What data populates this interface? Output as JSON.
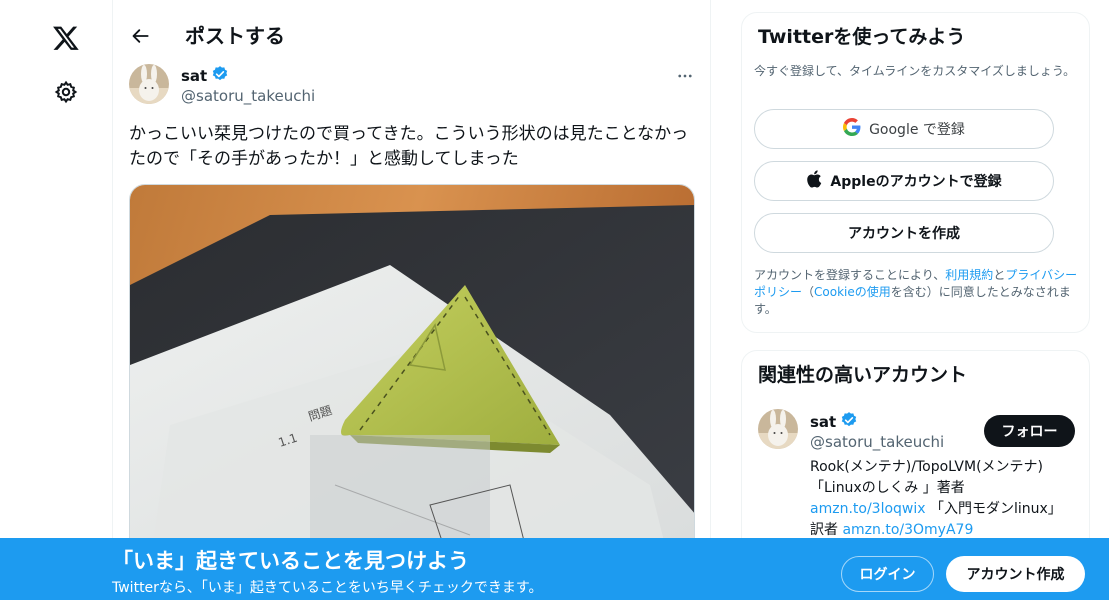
{
  "nav": {
    "logo_icon": "x-logo-icon",
    "settings_icon": "gear-icon"
  },
  "header": {
    "title": "ポストする"
  },
  "post": {
    "author_name": "sat",
    "author_handle": "@satoru_takeuchi",
    "text_lines": [
      "かっこいい栞見つけたので買ってきた。こういう形状のは見たことなかっ",
      "たので「その手があったか！」と感動してしまった"
    ],
    "media_texts": [
      "1.1",
      "問題"
    ]
  },
  "signup": {
    "title": "Twitterを使ってみよう",
    "subtitle": "今すぐ登録して、タイムラインをカスタマイズしましょう。",
    "google_label": "Google で登録",
    "apple_label": "Appleのアカウントで登録",
    "create_label": "アカウントを作成",
    "terms_part1": "アカウントを登録することにより、",
    "terms_link1": "利用規約",
    "terms_part2": "と",
    "terms_link2": "プライバシーポリシー",
    "terms_part3": "（",
    "terms_link3": "Cookieの使用",
    "terms_part4": "を含む）に同意したとみなされます。"
  },
  "related": {
    "title": "関連性の高いアカウント",
    "name": "sat",
    "handle": "@satoru_takeuchi",
    "follow_label": "フォロー",
    "bio_line1": "Rook(メンテナ)/TopoLVM(メンテナ)",
    "bio_line2": "「Linuxのしくみ 」著者",
    "bio_link1": "amzn.to/3loqwix",
    "bio_text3": " 「入門モダンlinux」",
    "bio_text4": "訳者 ",
    "bio_link2": "amzn.to/3OmyA79"
  },
  "banner": {
    "title": "「いま」起きていることを見つけよう",
    "subtitle": "Twitterなら、「いま」起きていることをいち早くチェックできます。",
    "login_label": "ログイン",
    "signup_label": "アカウント作成"
  },
  "colors": {
    "accent": "#1d9bf0",
    "verified": "#1d9bf0",
    "text": "#0f1419",
    "secondary": "#536471"
  }
}
